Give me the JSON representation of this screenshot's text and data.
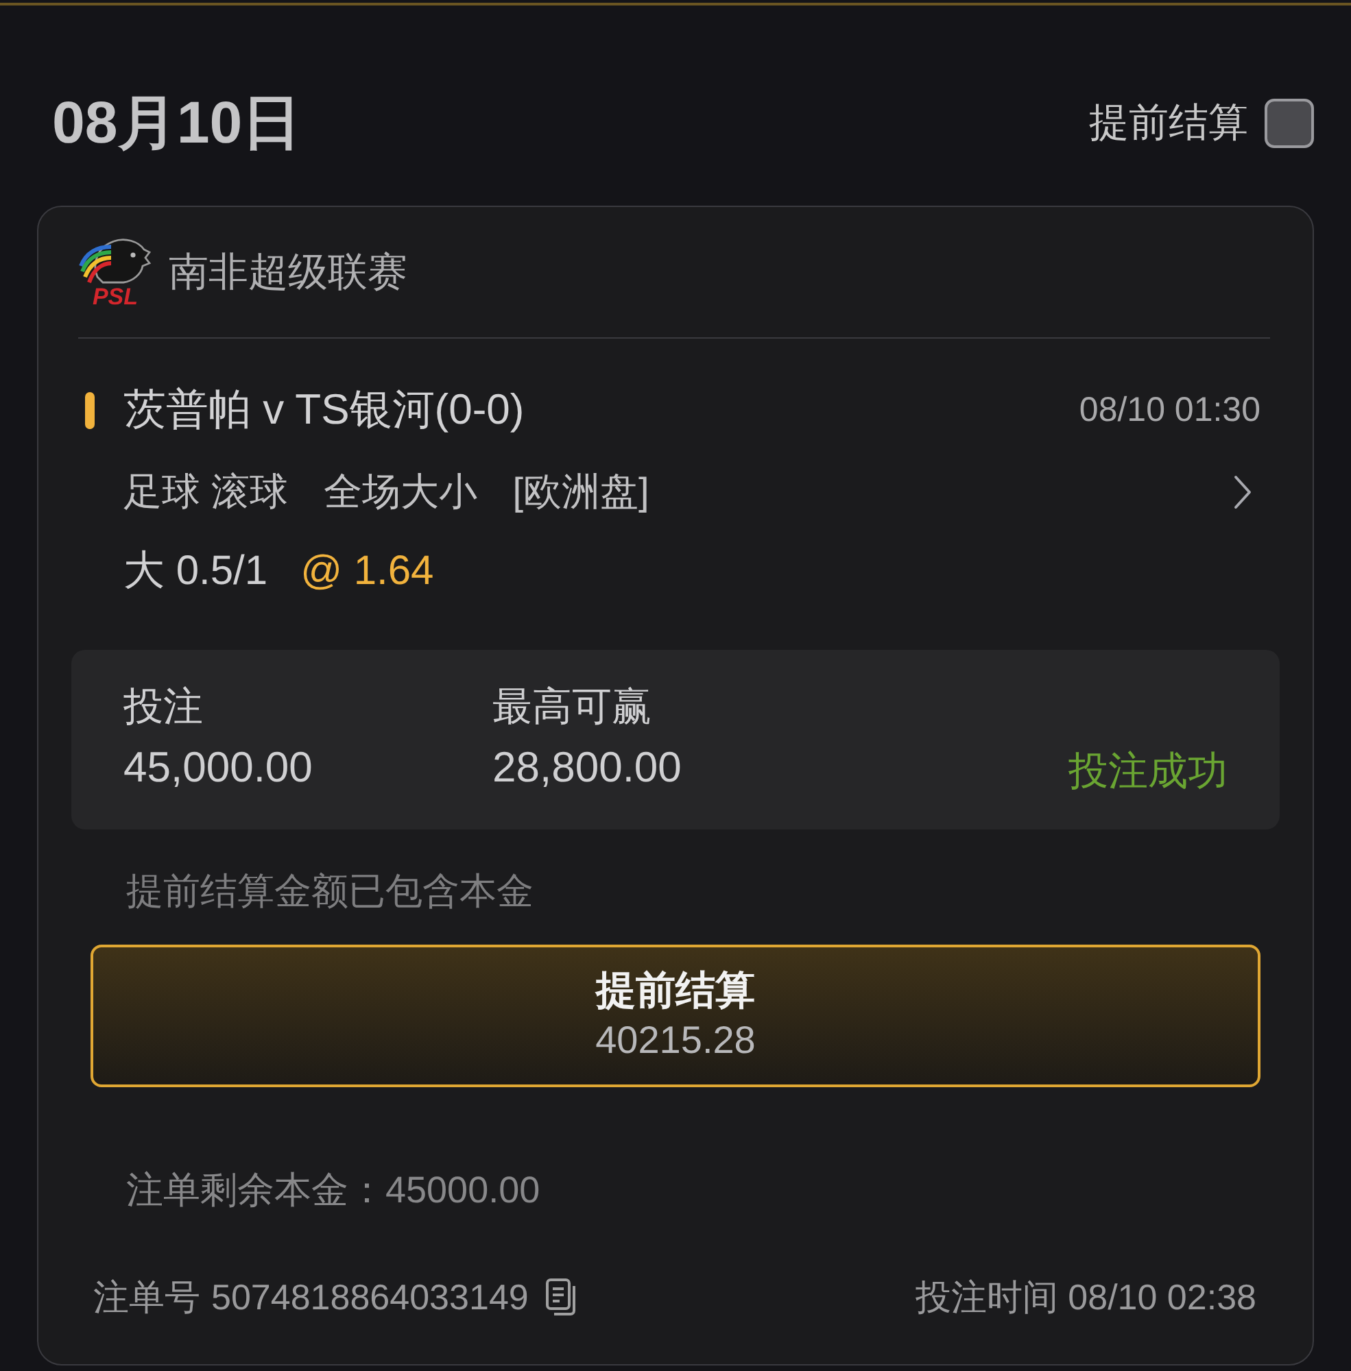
{
  "header": {
    "date": "08月10日",
    "early_settle": {
      "label": "提前结算",
      "checked": false
    }
  },
  "bet_card": {
    "league": {
      "name": "南非超级联赛",
      "logo_text": "PSL"
    },
    "match": {
      "title": "茨普帕 v TS银河(0-0)",
      "time": "08/10 01:30"
    },
    "market": [
      "足球 滚球",
      "全场大小",
      "[欧洲盘]"
    ],
    "selection": {
      "pick": "大 0.5/1",
      "odds": "@ 1.64"
    },
    "summary": {
      "stake_label": "投注",
      "stake": "45,000.00",
      "max_win_label": "最高可赢",
      "max_win": "28,800.00",
      "status": "投注成功"
    },
    "note": "提前结算金额已包含本金",
    "cash_out_button": {
      "label": "提前结算",
      "amount": "40215.28"
    },
    "remaining": "注单剩余本金：45000.00",
    "bet_id_label": "注单号",
    "bet_id": "5074818864033149",
    "bet_time": "投注时间 08/10 02:38"
  }
}
